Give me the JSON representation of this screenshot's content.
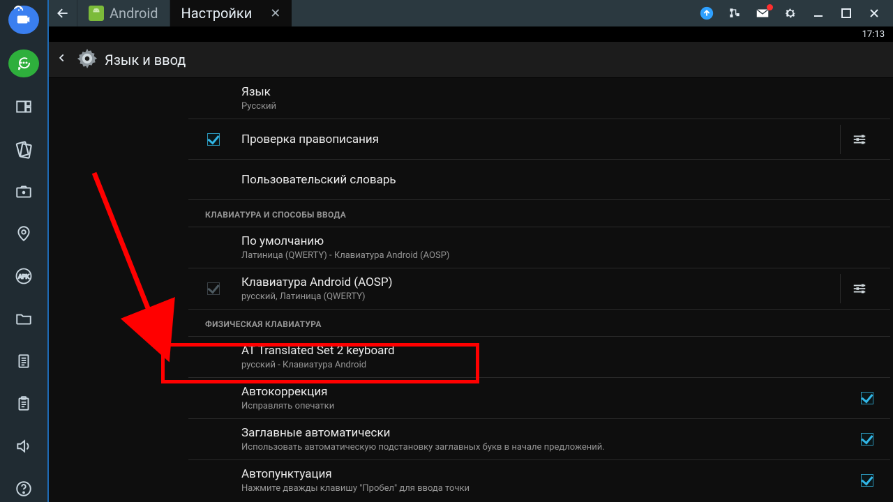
{
  "titlebar": {
    "tab_android": "Android",
    "tab_settings": "Настройки"
  },
  "statusbar": {
    "time": "17:13"
  },
  "actionbar": {
    "title": "Язык и ввод"
  },
  "rows": {
    "language": {
      "title": "Язык",
      "sub": "Русский"
    },
    "spellcheck": {
      "title": "Проверка правописания"
    },
    "userdict": {
      "title": "Пользовательский словарь"
    },
    "section_kb": "КЛАВИАТУРА И СПОСОБЫ ВВОДА",
    "default_im": {
      "title": "По умолчанию",
      "sub": "Латиница (QWERTY) - Клавиатура Android (AOSP)"
    },
    "android_kb": {
      "title": "Клавиатура Android (AOSP)",
      "sub": "русский, Латиница (QWERTY)"
    },
    "section_phys": "ФИЗИЧЕСКАЯ КЛАВИАТУРА",
    "phys_kb": {
      "title": "AT Translated Set 2 keyboard",
      "sub": "русский - Клавиатура Android"
    },
    "autocorrect": {
      "title": "Автокоррекция",
      "sub": "Исправлять опечатки"
    },
    "autocaps": {
      "title": "Заглавные автоматически",
      "sub": "Использовать автоматическую подстановку заглавных букв в начале предложений."
    },
    "autopunct": {
      "title": "Автопунктуация",
      "sub": "Нажмите дважды клавишу \"Пробел\" для ввода точки"
    }
  }
}
